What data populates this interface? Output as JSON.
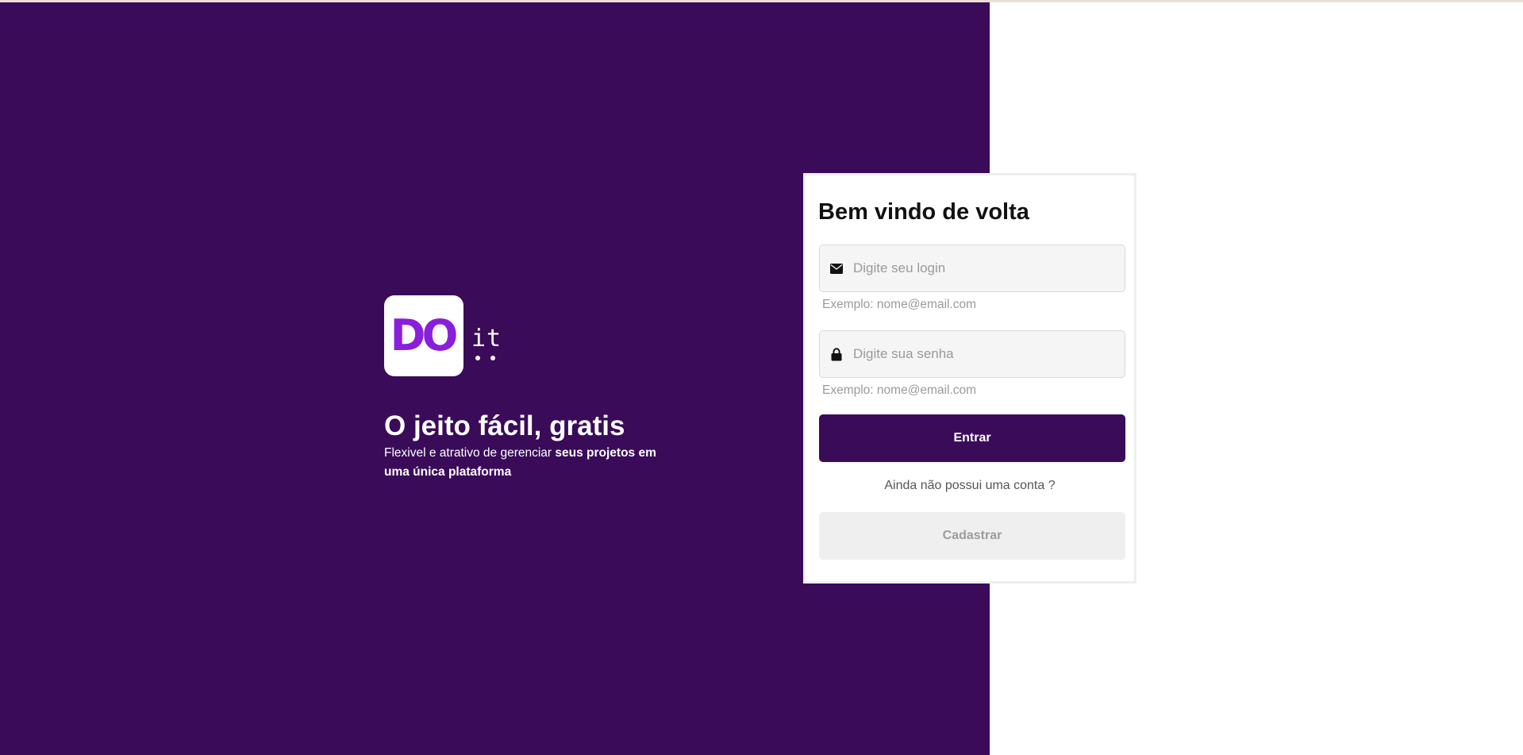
{
  "hero": {
    "logo": {
      "main": "DO",
      "suffix": "it"
    },
    "title": "O jeito fácil, gratis",
    "subtitle_plain": "Flexivel e atrativo de gerenciar ",
    "subtitle_bold": "seus projetos em uma única plataforma"
  },
  "login_form": {
    "title": "Bem vindo de volta",
    "login_field": {
      "placeholder": "Digite seu login",
      "value": "",
      "icon": "envelope-icon",
      "helper": "Exemplo: nome@email.com"
    },
    "password_field": {
      "placeholder": "Digite sua senha",
      "value": "",
      "icon": "lock-icon",
      "helper": "Exemplo: nome@email.com"
    },
    "submit_label": "Entrar",
    "no_account_text": "Ainda não possui uma conta ?",
    "register_label": "Cadastrar"
  },
  "colors": {
    "primary": "#3a0b59",
    "logo_accent": "#8a1fd9",
    "background": "#ffffff",
    "input_bg": "#f5f5f5",
    "secondary_button_bg": "#efefef"
  }
}
